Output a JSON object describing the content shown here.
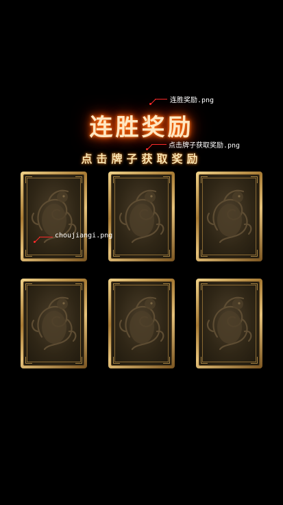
{
  "title": "连胜奖励",
  "subtitle": "点击牌子获取奖励",
  "annotations": {
    "title_file": "连胜奖励.png",
    "subtitle_file": "点击牌子获取奖励.png",
    "card_file": "choujiangi.png"
  },
  "cards": [
    {
      "icon": "dragon-icon"
    },
    {
      "icon": "dragon-icon"
    },
    {
      "icon": "dragon-icon"
    },
    {
      "icon": "dragon-icon"
    },
    {
      "icon": "dragon-icon"
    },
    {
      "icon": "dragon-icon"
    }
  ],
  "colors": {
    "background": "#000000",
    "card_border": "#c9a25a",
    "card_face": "#3a301e",
    "annotation_line": "#ff2a2a"
  }
}
